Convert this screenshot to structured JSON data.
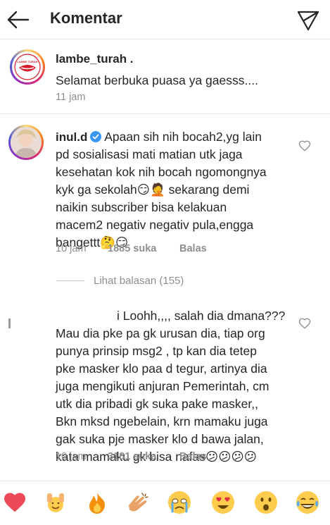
{
  "header": {
    "title": "Komentar"
  },
  "caption": {
    "username": "lambe_turah .",
    "logo_text": "LAMBE TURAH",
    "text": "Selamat berbuka puasa ya gaesss....",
    "time": "11 jam"
  },
  "comments": [
    {
      "username": "inul.d",
      "lines": [
        "Apaan sih nih bocah2,yg lain",
        "pd sosialisasi mati matian utk jaga",
        "kesehatan kok nih bocah ngomongnya",
        "kyk ga sekolah😏🤦 sekarang demi",
        "naikin subscriber bisa kelakuan",
        "macem2 negativ negativ pula,engga",
        "bangettt🤔😏"
      ],
      "time": "10 jam",
      "likes": "1885 suka",
      "reply": "Balas",
      "view_replies": "Lihat balasan (155)"
    },
    {
      "username_redacted": true,
      "lines": [
        "i Loohh,,,, salah dia dmana???",
        "Mau dia pke pa gk urusan dia, tiap org",
        "punya prinsip msg2 ,  tp kan dia tetep",
        "pke masker klo paa d tegur, artinya dia",
        "juga mengikuti anjuran Pemerintah, cm",
        "utk dia pribadi gk suka pake  masker,,",
        "Bkn mksd ngebelain, krn mamaku juga",
        "gak suka pje masker klo d bawa jalan,",
        "kata mamaku gk bisa nafas😕😕😕😕"
      ],
      "time": "10 jam",
      "likes": "3181 suka",
      "reply": "Balas"
    }
  ],
  "emoji_bar": [
    {
      "name": "red-heart",
      "glyph": "❤"
    },
    {
      "name": "raising-hands",
      "glyph": "🙌"
    },
    {
      "name": "fire",
      "glyph": "🔥"
    },
    {
      "name": "clapping-hands",
      "glyph": "👏"
    },
    {
      "name": "crying-face",
      "glyph": "😢"
    },
    {
      "name": "heart-eyes",
      "glyph": "😍"
    },
    {
      "name": "surprised-face",
      "glyph": "😮"
    },
    {
      "name": "tears-of-joy",
      "glyph": "😂"
    }
  ],
  "colors": {
    "text": "#262626",
    "secondary": "#8e8e8e",
    "verified": "#3897f0",
    "heart_red": "#ed4956"
  }
}
